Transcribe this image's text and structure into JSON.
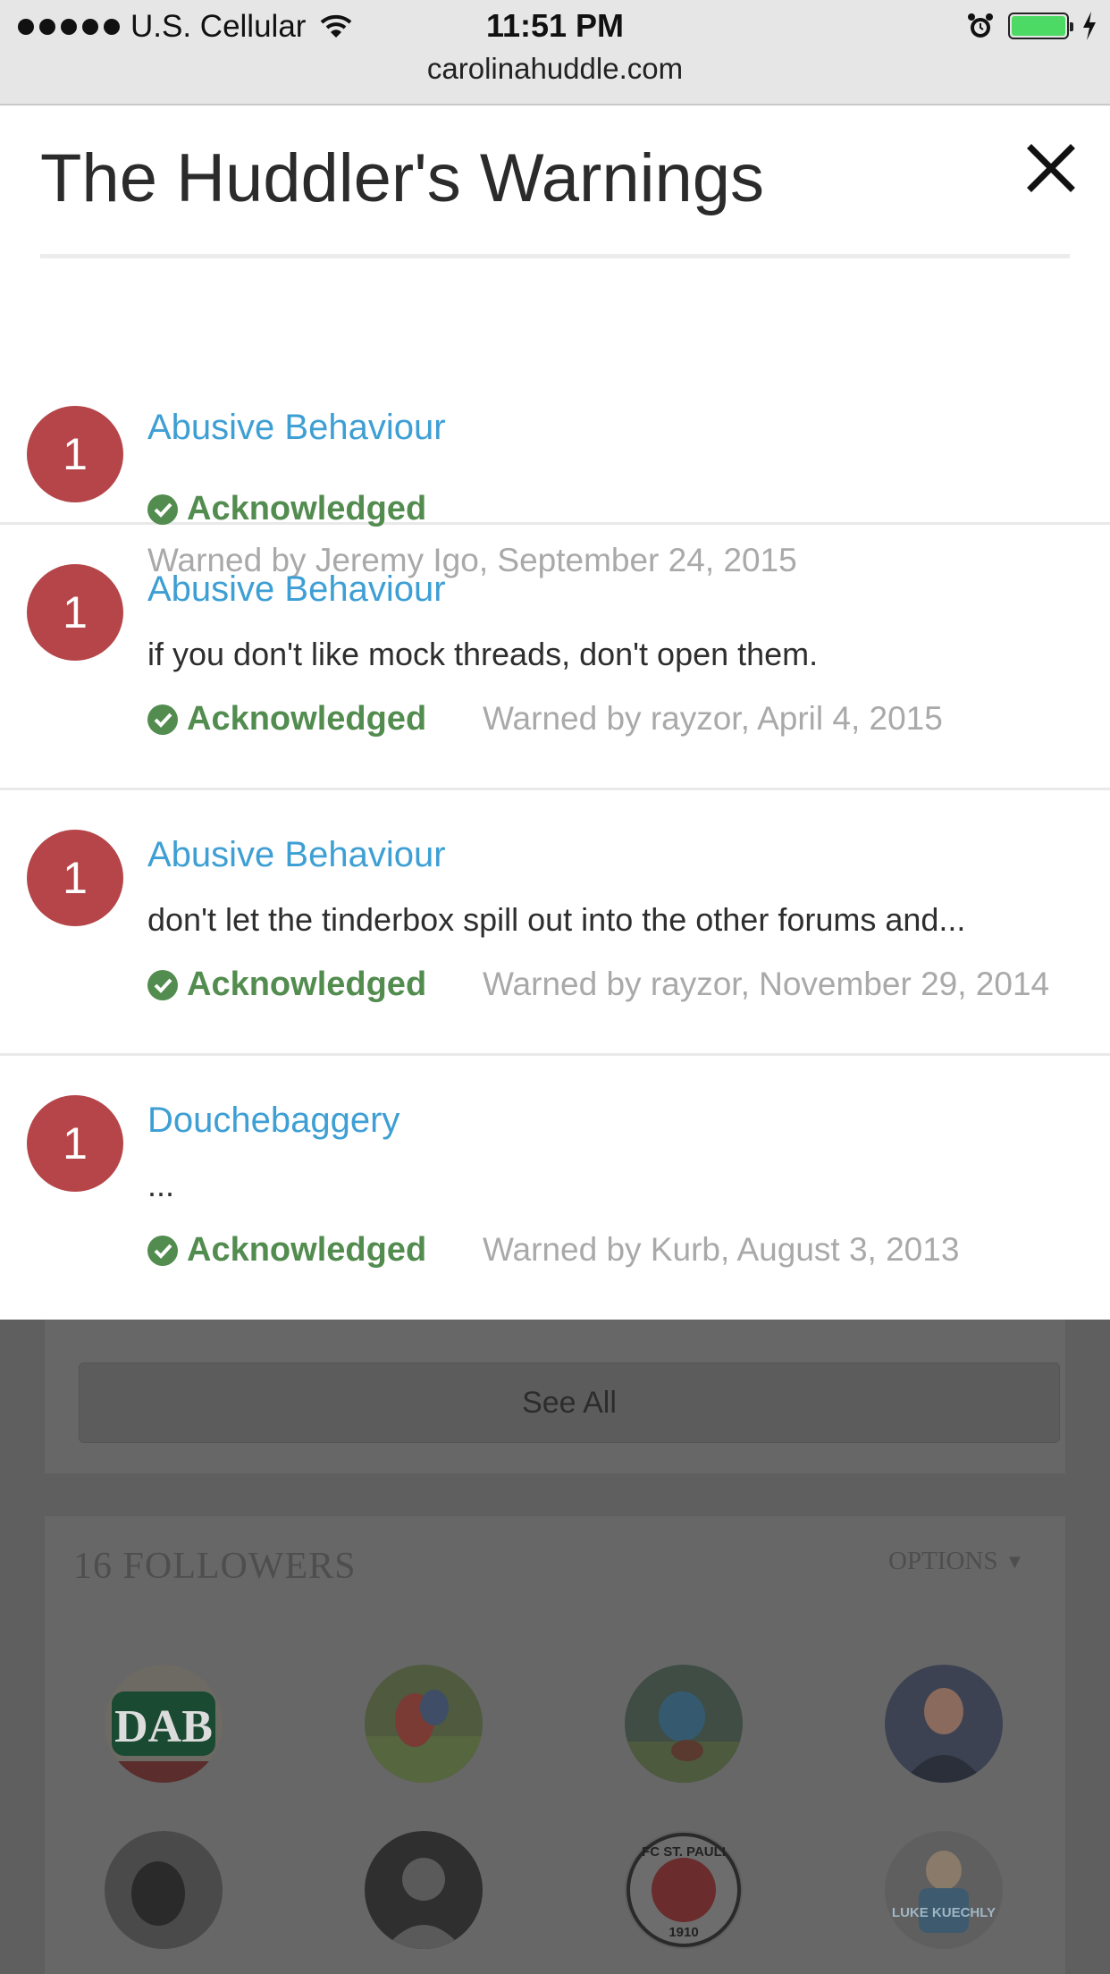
{
  "status_bar": {
    "carrier": "U.S. Cellular",
    "time": "11:51 PM",
    "url": "carolinahuddle.com"
  },
  "modal": {
    "title": "The Huddler's Warnings",
    "close_icon": "close-icon",
    "warnings": [
      {
        "points": "1",
        "reason": "Abusive Behaviour",
        "note": "",
        "status": "Acknowledged",
        "warned_by": "Warned by Jeremy Igo, September 24, 2015"
      },
      {
        "points": "1",
        "reason": "Abusive Behaviour",
        "note": "if you don't like mock threads, don't open them.",
        "status": "Acknowledged",
        "warned_by": "Warned by rayzor, April 4, 2015"
      },
      {
        "points": "1",
        "reason": "Abusive Behaviour",
        "note": "don't let the tinderbox spill out into the other forums and...",
        "status": "Acknowledged",
        "warned_by": "Warned by rayzor, November 29, 2014"
      },
      {
        "points": "1",
        "reason": "Douchebaggery",
        "note": "...",
        "status": "Acknowledged",
        "warned_by": "Warned by Kurb, August 3, 2013"
      }
    ]
  },
  "background": {
    "see_all": "See All",
    "followers_title": "16 FOLLOWERS",
    "options_label": "OPTIONS",
    "avatar_texts": [
      "DAB",
      "FC ST. PAULI",
      "1910",
      "LUKE KUECHLY"
    ]
  },
  "colors": {
    "badge": "#b54548",
    "link": "#3e9fd4",
    "acknowledged": "#528c4f",
    "meta": "#a9a9a9"
  }
}
